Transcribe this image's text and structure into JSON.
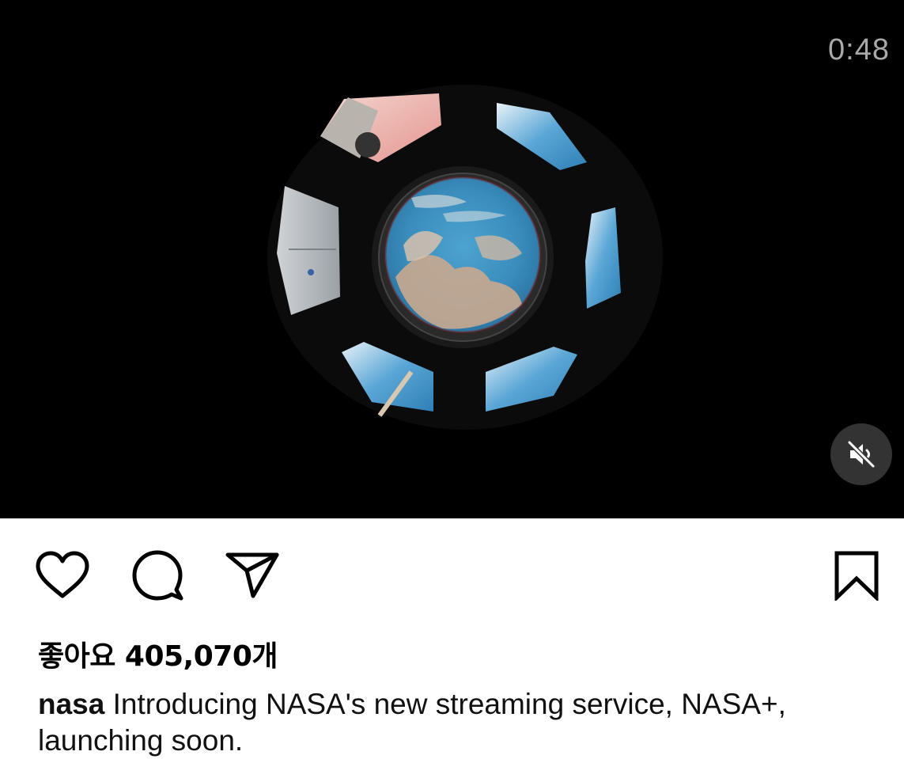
{
  "video": {
    "timer": "0:48",
    "description_icon": "space-station-cupola-view",
    "mute_icon": "muted-speaker-icon"
  },
  "actions": {
    "like_icon": "heart-icon",
    "comment_icon": "comment-bubble-icon",
    "share_icon": "paper-plane-icon",
    "save_icon": "bookmark-icon"
  },
  "likes": {
    "text": "좋아요 405,070개"
  },
  "caption": {
    "username": "nasa",
    "text": " Introducing NASA's new streaming service, NASA+, launching soon."
  },
  "colors": {
    "video_bg": "#000000",
    "timer": "#a9a9a9",
    "earth_blue": "#3f8fbf"
  }
}
